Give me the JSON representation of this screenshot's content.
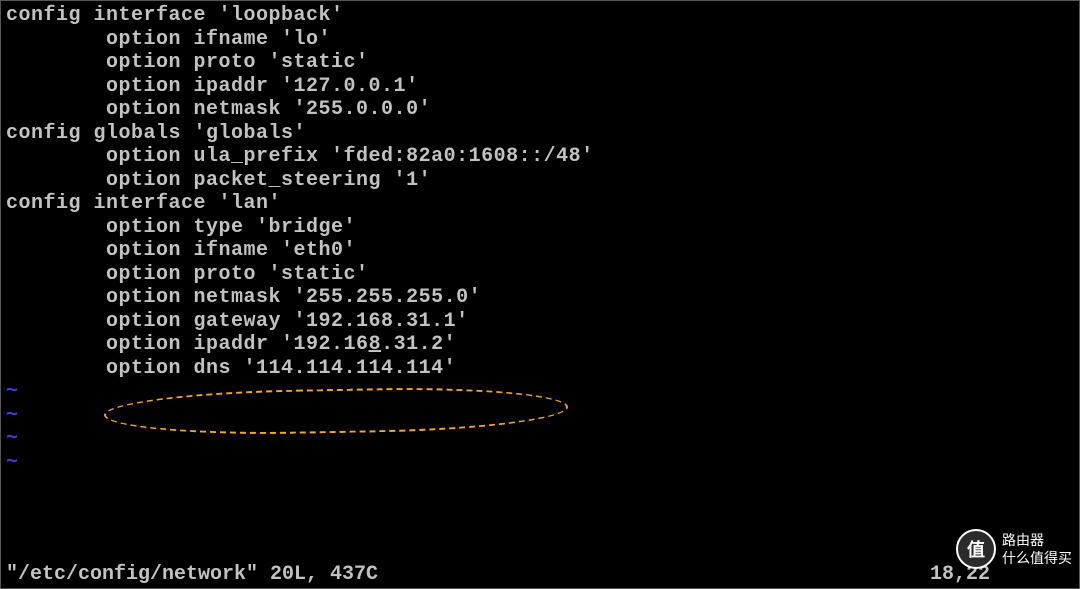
{
  "lines": [
    "config interface 'loopback'",
    "        option ifname 'lo'",
    "        option proto 'static'",
    "        option ipaddr '127.0.0.1'",
    "        option netmask '255.0.0.0'",
    "",
    "config globals 'globals'",
    "        option ula_prefix 'fded:82a0:1608::/48'",
    "        option packet_steering '1'",
    "",
    "config interface 'lan'",
    "        option type 'bridge'",
    "        option ifname 'eth0'",
    "        option proto 'static'",
    "        option netmask '255.255.255.0'",
    "        option gateway '192.168.31.1'",
    "        option ipaddr '192.168.31.2'",
    "        option dns '114.114.114.114'"
  ],
  "tildes": [
    "~",
    "~",
    "~",
    "~"
  ],
  "cursor": {
    "line_index": 16,
    "col": 29
  },
  "status": {
    "left": "\"/etc/config/network\" 20L, 437C",
    "right": "18,22       "
  },
  "watermark": {
    "badge": "值",
    "line1": "路由器",
    "line2": "什么值得买"
  }
}
